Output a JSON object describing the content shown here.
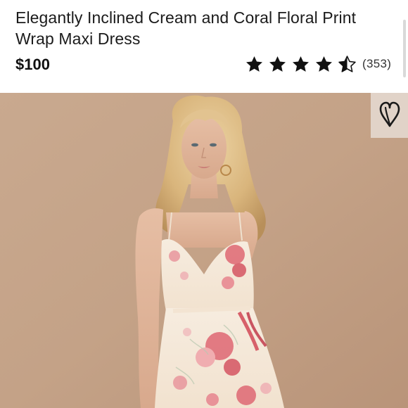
{
  "product": {
    "title": "Elegantly Inclined Cream and Coral Floral Print Wrap Maxi Dress",
    "price": "$100",
    "rating": {
      "value": 4.5,
      "max": 5,
      "review_count": "(353)"
    }
  },
  "favorite": {
    "icon": "heart-outline-icon"
  },
  "image": {
    "subject": "product-photo"
  },
  "colors": {
    "background": "#ffffff",
    "text": "#1b1b1b",
    "star": "#111111",
    "photo_backdrop": "#c8a78d",
    "dress_cream": "#f4e8d8",
    "dress_coral": "#e0707a"
  }
}
